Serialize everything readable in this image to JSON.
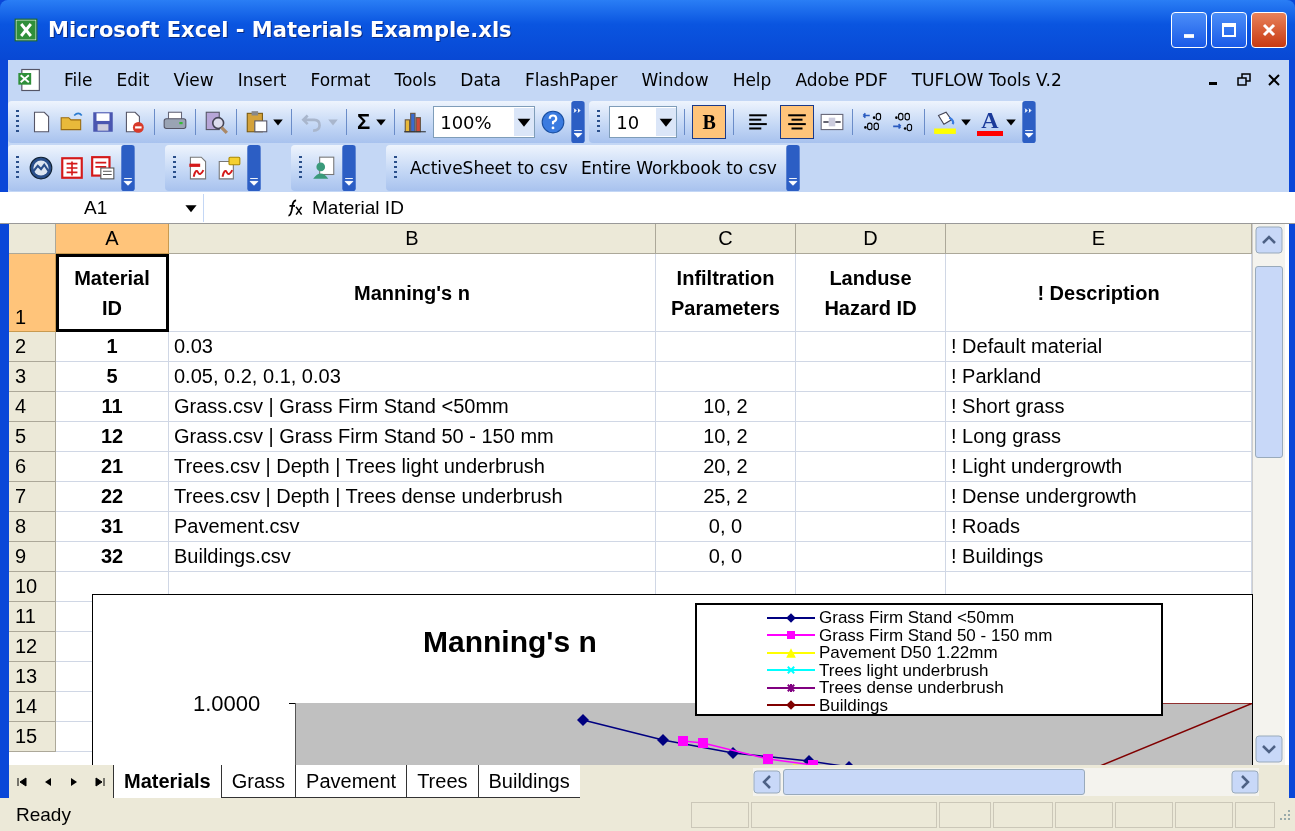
{
  "window": {
    "title": "Microsoft Excel - Materials Example.xls"
  },
  "menu": [
    "File",
    "Edit",
    "View",
    "Insert",
    "Format",
    "Tools",
    "Data",
    "FlashPaper",
    "Window",
    "Help",
    "Adobe PDF",
    "TUFLOW Tools V.2"
  ],
  "standard_toolbar": {
    "autosum": "Σ",
    "zoom": "100%",
    "undo": {
      "disabled": true
    }
  },
  "formatting_toolbar": {
    "font_size": "10",
    "bold": {
      "label": "B",
      "pressed": true
    },
    "alignment": [
      {
        "selected": false
      },
      {
        "selected": true
      }
    ],
    "font_color": {
      "label": "A"
    }
  },
  "csv_toolbar": [
    "ActiveSheet to csv",
    "Entire Workbook to csv"
  ],
  "formula_bar": {
    "name_box": "A1",
    "value": "Material ID"
  },
  "sheet": {
    "columns": [
      {
        "label": "A",
        "selected": true
      },
      {
        "label": "B",
        "selected": false
      },
      {
        "label": "C",
        "selected": false
      },
      {
        "label": "D",
        "selected": false
      },
      {
        "label": "E",
        "selected": false
      }
    ],
    "rows": [
      {
        "number": "1",
        "selected": true,
        "a": "Material ID",
        "b": "Manning's n",
        "c": "Infiltration Parameters",
        "d": "Landuse Hazard ID",
        "e": "! Description"
      },
      {
        "number": "2",
        "selected": false,
        "a": "1",
        "b": "0.03",
        "e": "! Default material"
      },
      {
        "number": "3",
        "selected": false,
        "a": "5",
        "b": "0.05, 0.2, 0.1, 0.03",
        "e": "! Parkland"
      },
      {
        "number": "4",
        "selected": false,
        "a": "11",
        "b": "Grass.csv | Grass Firm Stand <50mm",
        "c": "10, 2",
        "e": "! Short grass"
      },
      {
        "number": "5",
        "selected": false,
        "a": "12",
        "b": "Grass.csv | Grass Firm Stand 50 - 150 mm",
        "c": "10, 2",
        "e": "! Long grass"
      },
      {
        "number": "6",
        "selected": false,
        "a": "21",
        "b": "Trees.csv | Depth | Trees light underbrush",
        "c": "20, 2",
        "e": "! Light undergrowth"
      },
      {
        "number": "7",
        "selected": false,
        "a": "22",
        "b": "Trees.csv | Depth | Trees dense underbrush",
        "c": "25, 2",
        "e": "! Dense undergrowth"
      },
      {
        "number": "8",
        "selected": false,
        "a": "31",
        "b": "Pavement.csv",
        "c": "0, 0",
        "e": "! Roads"
      },
      {
        "number": "9",
        "selected": false,
        "a": "32",
        "b": "Buildings.csv",
        "c": "0, 0",
        "e": "! Buildings"
      },
      {
        "number": "10",
        "selected": false
      },
      {
        "number": "11",
        "selected": false
      },
      {
        "number": "12",
        "selected": false
      },
      {
        "number": "13",
        "selected": false
      },
      {
        "number": "14",
        "selected": false
      },
      {
        "number": "15",
        "selected": false
      }
    ]
  },
  "chart": {
    "title": "Manning's n",
    "y_tick": "1.0000",
    "legend": [
      {
        "label": "Grass Firm Stand <50mm",
        "color": "#000080",
        "kind": "diamond"
      },
      {
        "label": "Grass Firm Stand 50 - 150 mm",
        "color": "#ff00ff",
        "kind": "square"
      },
      {
        "label": "Pavement D50 1.22mm",
        "color": "#ffff00",
        "kind": "triangle"
      },
      {
        "label": "Trees light underbrush",
        "color": "#00ffff",
        "kind": "cross"
      },
      {
        "label": "Trees dense underbrush",
        "color": "#800080",
        "kind": "star"
      },
      {
        "label": "Buildings",
        "color": "#800000",
        "kind": "diamond"
      }
    ]
  },
  "sheet_tabs": [
    {
      "label": "Materials",
      "selected": true
    },
    {
      "label": "Grass",
      "selected": false
    },
    {
      "label": "Pavement",
      "selected": false
    },
    {
      "label": "Trees",
      "selected": false
    },
    {
      "label": "Buildings",
      "selected": false
    }
  ],
  "status_bar": {
    "text": "Ready"
  }
}
